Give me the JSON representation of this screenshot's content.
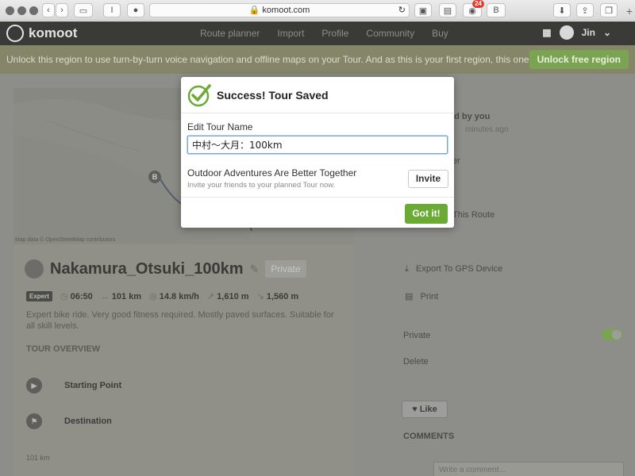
{
  "browser": {
    "url": "komoot.com",
    "extension_badge": "24",
    "extension_letter": "B"
  },
  "site": {
    "logo_text": "komoot",
    "nav": [
      "Route planner",
      "Import",
      "Profile",
      "Community",
      "Buy"
    ],
    "user_name": "Jin",
    "promo_text": "Unlock this region to use turn-by-turn voice navigation and offline maps on your Tour. And as this is your first region, this one's on us.",
    "promo_button": "Unlock free region"
  },
  "tour": {
    "map_credit": "Map data © OpenStreetMap contributors",
    "marker_label": "B",
    "title": "Nakamura_Otsuki_100km",
    "visibility_badge": "Private",
    "difficulty": "Expert",
    "duration": "06:50",
    "distance": "101 km",
    "speed": "14.8 km/h",
    "ascent": "1,610 m",
    "descent": "1,560 m",
    "description": "Expert bike ride. Very good fitness required. Mostly paved surfaces. Suitable for all skill levels.",
    "overview_heading": "TOUR OVERVIEW",
    "start_label": "Starting Point",
    "destination_label": "Destination",
    "destination_distance": "101 km"
  },
  "sidebar": {
    "created_by": "ed by you",
    "created_time": "minutes ago",
    "item_er": "er",
    "item_route": "This Route",
    "export_label": "Export To GPS Device",
    "print_label": "Print",
    "private_label": "Private",
    "delete_label": "Delete",
    "like_label": "Like",
    "comments_heading": "COMMENTS",
    "comment_placeholder": "Write a comment..."
  },
  "modal": {
    "title": "Success! Tour Saved",
    "field_label": "Edit Tour Name",
    "tour_name_value": "中村〜大月：100km",
    "invite_title": "Outdoor Adventures Are Better Together",
    "invite_subtitle": "Invite your friends to your planned Tour now.",
    "invite_button": "Invite",
    "confirm_button": "Got it!"
  },
  "colors": {
    "accent_green": "#6aaa35",
    "overlay_dark": "#3a3a37"
  }
}
